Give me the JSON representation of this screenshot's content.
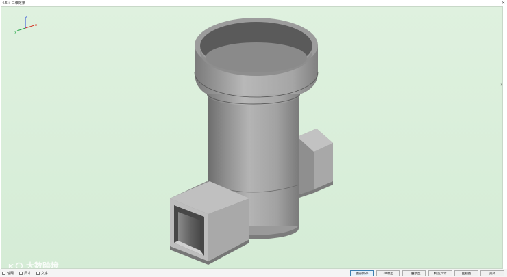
{
  "window": {
    "title": "4.5+ 三维效果",
    "minimize_glyph": "—",
    "close_glyph": "✕"
  },
  "gizmo": {
    "x_label": "x",
    "y_label": "y",
    "z_label": "z",
    "colors": {
      "x": "#d63a2a",
      "y": "#2aa84a",
      "z": "#2a4ad6"
    }
  },
  "viewport": {
    "background": "#d8eed9",
    "model_color": "#9a9a9a"
  },
  "watermark": {
    "text": "大数跨境"
  },
  "bottom": {
    "checkboxes": [
      {
        "label": "轴网"
      },
      {
        "label": "尺寸"
      },
      {
        "label": "文字"
      }
    ],
    "buttons": [
      {
        "label": "图形保存"
      },
      {
        "label": "3D模型"
      },
      {
        "label": "二维模型"
      },
      {
        "label": "构造尺寸"
      },
      {
        "label": "主视图"
      },
      {
        "label": "关闭"
      }
    ]
  }
}
